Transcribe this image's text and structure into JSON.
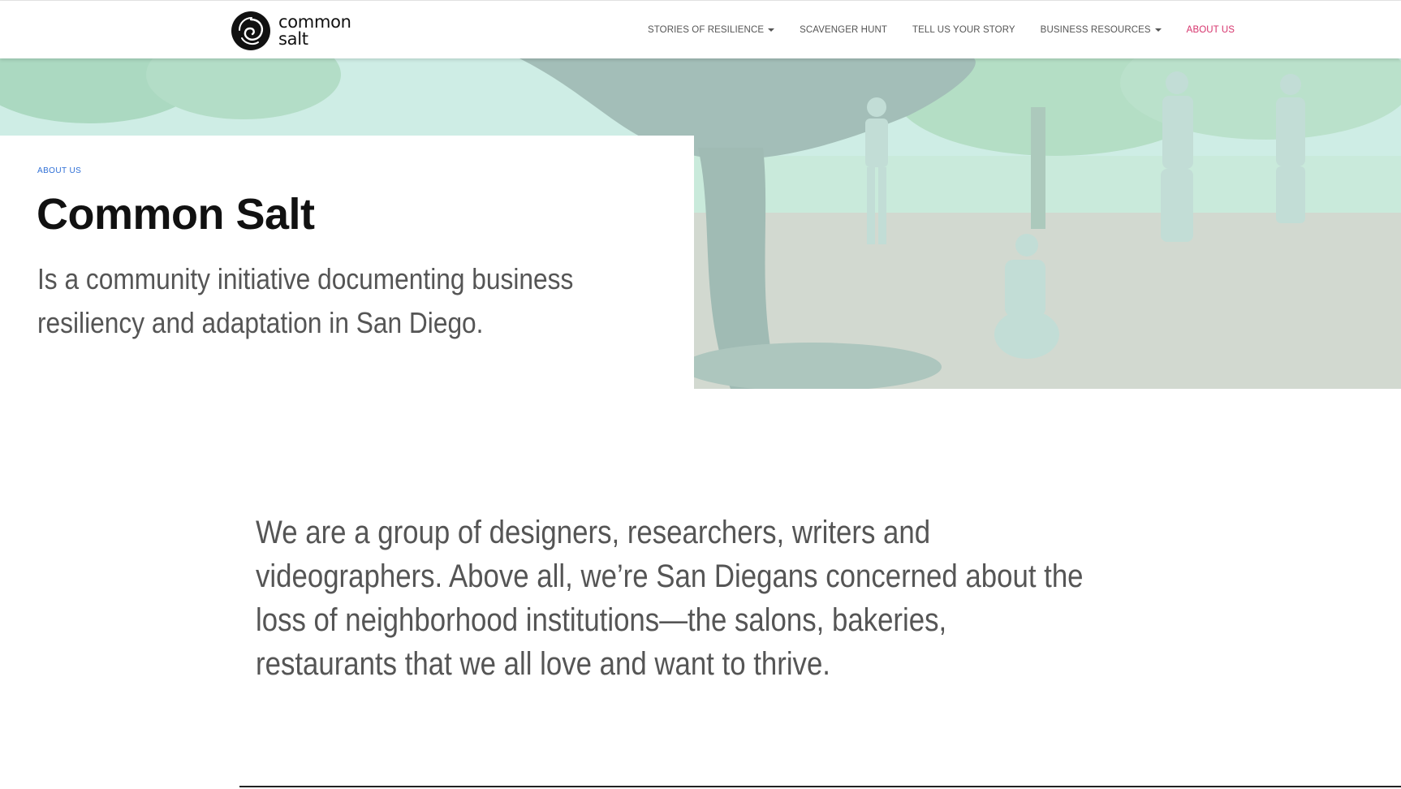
{
  "brand": {
    "line1": "common",
    "line2": "salt"
  },
  "nav": [
    {
      "label": "STORIES OF RESILIENCE",
      "dropdown": true,
      "active": false
    },
    {
      "label": "SCAVENGER HUNT",
      "dropdown": false,
      "active": false
    },
    {
      "label": "TELL US YOUR STORY",
      "dropdown": false,
      "active": false
    },
    {
      "label": "BUSINESS RESOURCES",
      "dropdown": true,
      "active": false
    },
    {
      "label": "ABOUT US",
      "dropdown": false,
      "active": true
    }
  ],
  "hero": {
    "eyebrow": "ABOUT US",
    "title": "Common Salt",
    "description": "Is a community initiative documenting business resiliency and adaptation in San Diego."
  },
  "mission": "We are a group of designers, researchers, writers and videographers. Above all, we’re San Diegans concerned about the loss of neighborhood institutions—the salons, bakeries, restaurants that we all love and want to thrive.",
  "colors": {
    "active_nav": "#d6336c",
    "eyebrow": "#2f6fd6",
    "body_text": "#555555",
    "hero_tint": "#c8ece2"
  }
}
